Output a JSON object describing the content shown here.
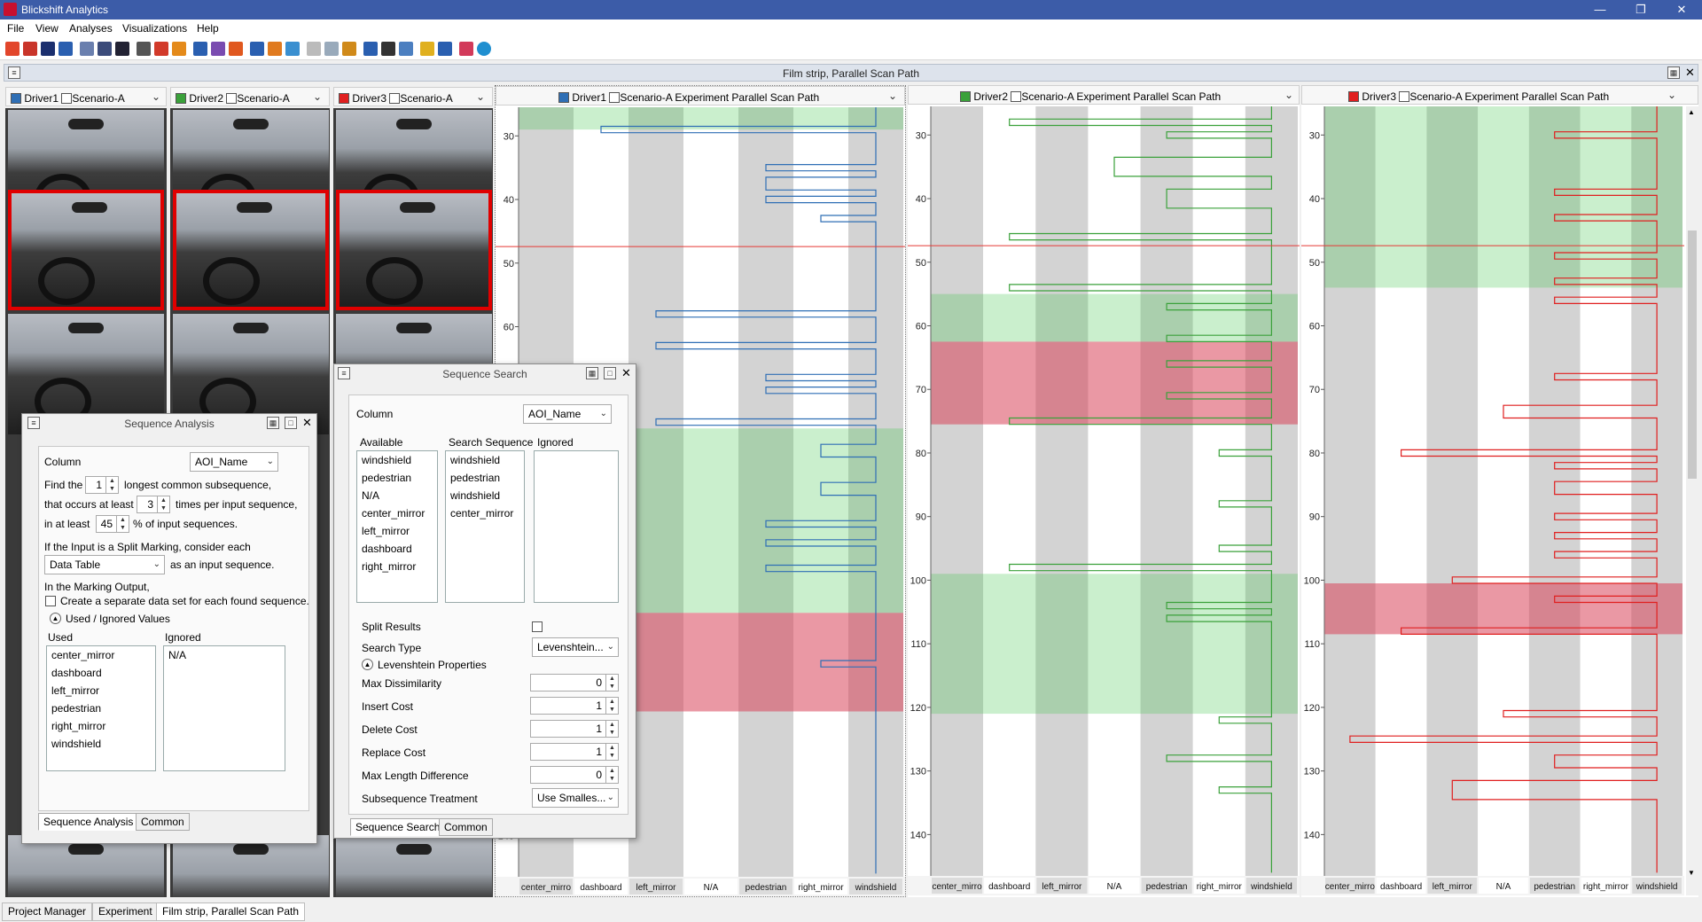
{
  "app": {
    "title": "Blickshift Analytics"
  },
  "menu": [
    "File",
    "View",
    "Analyses",
    "Visualizations",
    "Help"
  ],
  "dock_title": "Film strip, Parallel Scan Path",
  "filmstrips": [
    {
      "driver": "Driver1",
      "scenario": "Scenario-A",
      "color": "#2f6fb5"
    },
    {
      "driver": "Driver2",
      "scenario": "Scenario-A",
      "color": "#3aa13a"
    },
    {
      "driver": "Driver3",
      "scenario": "Scenario-A",
      "color": "#e01f1f"
    }
  ],
  "scanpaths": [
    {
      "driver": "Driver1",
      "scenario": "Scenario-A",
      "title_suffix": "Experiment Parallel Scan Path",
      "color": "#2f6fb5",
      "green_ranges": [
        [
          25,
          29
        ],
        [
          76,
          105
        ]
      ],
      "red_ranges": [
        [
          105,
          120.5
        ]
      ],
      "green_band_columns": "all"
    },
    {
      "driver": "Driver2",
      "scenario": "Scenario-A",
      "title_suffix": "Experiment Parallel Scan Path",
      "color": "#3aa13a",
      "green_ranges": [
        [
          55,
          62.5
        ],
        [
          99,
          121
        ]
      ],
      "red_ranges": [
        [
          62.5,
          75.5
        ]
      ],
      "green_band_columns": "all"
    },
    {
      "driver": "Driver3",
      "scenario": "Scenario-A",
      "title_suffix": "Experiment Parallel Scan Path",
      "color": "#e01f1f",
      "green_ranges": [
        [
          25,
          54
        ]
      ],
      "red_ranges": [
        [
          100.5,
          108.5
        ]
      ],
      "green_band_columns": "all"
    }
  ],
  "scanpath_axis": {
    "y_ticks": [
      30,
      40,
      50,
      60,
      70,
      80,
      90,
      100,
      110,
      120,
      130,
      140
    ],
    "ylim": [
      25.5,
      146.5
    ],
    "cursor_y": 47.4
  },
  "aoi_columns": [
    "center_mirro",
    "dashboard",
    "left_mirror",
    "N/A",
    "pedestrian",
    "right_mirror",
    "windshield"
  ],
  "chart_data": [
    {
      "type": "line",
      "title": "Driver1 Scenario-A Experiment Parallel Scan Path",
      "categories": [
        "center_mirror",
        "dashboard",
        "left_mirror",
        "N/A",
        "pedestrian",
        "right_mirror",
        "windshield"
      ],
      "points": [
        [
          6.5,
          25
        ],
        [
          6.5,
          28.5
        ],
        [
          1.5,
          28.5
        ],
        [
          1.5,
          29.5
        ],
        [
          6.5,
          29.5
        ],
        [
          6.5,
          34.5
        ],
        [
          4.5,
          34.5
        ],
        [
          4.5,
          35.5
        ],
        [
          6.5,
          35.5
        ],
        [
          6.5,
          36.5
        ],
        [
          4.5,
          36.5
        ],
        [
          4.5,
          38.5
        ],
        [
          6.5,
          38.5
        ],
        [
          6.5,
          39.5
        ],
        [
          4.5,
          39.5
        ],
        [
          4.5,
          40.5
        ],
        [
          6.5,
          40.5
        ],
        [
          6.5,
          42.5
        ],
        [
          5.5,
          42.5
        ],
        [
          5.5,
          43.5
        ],
        [
          6.5,
          43.5
        ],
        [
          6.5,
          57.5
        ],
        [
          2.5,
          57.5
        ],
        [
          2.5,
          58.5
        ],
        [
          6.5,
          58.5
        ],
        [
          6.5,
          62.5
        ],
        [
          2.5,
          62.5
        ],
        [
          2.5,
          63.5
        ],
        [
          6.5,
          63.5
        ],
        [
          6.5,
          67.5
        ],
        [
          4.5,
          67.5
        ],
        [
          4.5,
          68.5
        ],
        [
          6.5,
          68.5
        ],
        [
          6.5,
          69.5
        ],
        [
          4.5,
          69.5
        ],
        [
          4.5,
          70.5
        ],
        [
          6.5,
          70.5
        ],
        [
          6.5,
          74.5
        ],
        [
          2.5,
          74.5
        ],
        [
          2.5,
          75.5
        ],
        [
          6.5,
          75.5
        ],
        [
          6.5,
          78.5
        ],
        [
          5.5,
          78.5
        ],
        [
          5.5,
          80.5
        ],
        [
          6.5,
          80.5
        ],
        [
          6.5,
          84.5
        ],
        [
          5.5,
          84.5
        ],
        [
          5.5,
          86.5
        ],
        [
          6.5,
          86.5
        ],
        [
          6.5,
          90.5
        ],
        [
          4.5,
          90.5
        ],
        [
          4.5,
          91.5
        ],
        [
          6.5,
          91.5
        ],
        [
          6.5,
          93.5
        ],
        [
          4.5,
          93.5
        ],
        [
          4.5,
          94.5
        ],
        [
          6.5,
          94.5
        ],
        [
          6.5,
          97.5
        ],
        [
          4.5,
          97.5
        ],
        [
          4.5,
          98.5
        ],
        [
          6.5,
          98.5
        ],
        [
          6.5,
          112.5
        ],
        [
          5.5,
          112.5
        ],
        [
          5.5,
          113.5
        ],
        [
          6.5,
          113.5
        ],
        [
          6.5,
          146
        ]
      ]
    },
    {
      "type": "line",
      "title": "Driver2 Scenario-A Experiment Parallel Scan Path",
      "categories": [
        "center_mirror",
        "dashboard",
        "left_mirror",
        "N/A",
        "pedestrian",
        "right_mirror",
        "windshield"
      ],
      "points": [
        [
          6.5,
          25
        ],
        [
          6.5,
          27.5
        ],
        [
          1.5,
          27.5
        ],
        [
          1.5,
          28.5
        ],
        [
          6.5,
          28.5
        ],
        [
          6.5,
          29.5
        ],
        [
          4.5,
          29.5
        ],
        [
          4.5,
          30.5
        ],
        [
          6.5,
          30.5
        ],
        [
          6.5,
          33.5
        ],
        [
          3.5,
          33.5
        ],
        [
          3.5,
          36.5
        ],
        [
          6.5,
          36.5
        ],
        [
          6.5,
          38.5
        ],
        [
          4.5,
          38.5
        ],
        [
          4.5,
          41.5
        ],
        [
          6.5,
          41.5
        ],
        [
          6.5,
          45.5
        ],
        [
          1.5,
          45.5
        ],
        [
          1.5,
          46.5
        ],
        [
          6.5,
          46.5
        ],
        [
          6.5,
          53.5
        ],
        [
          1.5,
          53.5
        ],
        [
          1.5,
          54.5
        ],
        [
          6.5,
          54.5
        ],
        [
          6.5,
          56.5
        ],
        [
          4.5,
          56.5
        ],
        [
          4.5,
          57.5
        ],
        [
          6.5,
          57.5
        ],
        [
          6.5,
          61.5
        ],
        [
          4.5,
          61.5
        ],
        [
          4.5,
          62.5
        ],
        [
          6.5,
          62.5
        ],
        [
          6.5,
          65.5
        ],
        [
          4.5,
          65.5
        ],
        [
          4.5,
          66.5
        ],
        [
          6.5,
          66.5
        ],
        [
          6.5,
          70.5
        ],
        [
          4.5,
          70.5
        ],
        [
          4.5,
          71.5
        ],
        [
          6.5,
          71.5
        ],
        [
          6.5,
          74.5
        ],
        [
          1.5,
          74.5
        ],
        [
          1.5,
          75.5
        ],
        [
          6.5,
          75.5
        ],
        [
          6.5,
          79.5
        ],
        [
          5.5,
          79.5
        ],
        [
          5.5,
          80.5
        ],
        [
          6.5,
          80.5
        ],
        [
          6.5,
          87.5
        ],
        [
          5.5,
          87.5
        ],
        [
          5.5,
          88.5
        ],
        [
          6.5,
          88.5
        ],
        [
          6.5,
          94.5
        ],
        [
          5.5,
          94.5
        ],
        [
          5.5,
          95.5
        ],
        [
          6.5,
          95.5
        ],
        [
          6.5,
          97.5
        ],
        [
          1.5,
          97.5
        ],
        [
          1.5,
          98.5
        ],
        [
          6.5,
          98.5
        ],
        [
          6.5,
          103.5
        ],
        [
          4.5,
          103.5
        ],
        [
          4.5,
          104.5
        ],
        [
          6.5,
          104.5
        ],
        [
          6.5,
          105.5
        ],
        [
          4.5,
          105.5
        ],
        [
          4.5,
          106.5
        ],
        [
          6.5,
          106.5
        ],
        [
          6.5,
          121.5
        ],
        [
          5.5,
          121.5
        ],
        [
          5.5,
          122.5
        ],
        [
          6.5,
          122.5
        ],
        [
          6.5,
          127.5
        ],
        [
          4.5,
          127.5
        ],
        [
          4.5,
          128.5
        ],
        [
          6.5,
          128.5
        ],
        [
          6.5,
          132.5
        ],
        [
          5.5,
          132.5
        ],
        [
          5.5,
          133.5
        ],
        [
          6.5,
          133.5
        ],
        [
          6.5,
          146
        ]
      ]
    },
    {
      "type": "line",
      "title": "Driver3 Scenario-A Experiment Parallel Scan Path",
      "categories": [
        "center_mirror",
        "dashboard",
        "left_mirror",
        "N/A",
        "pedestrian",
        "right_mirror",
        "windshield"
      ],
      "points": [
        [
          6.5,
          25
        ],
        [
          6.5,
          29.5
        ],
        [
          4.5,
          29.5
        ],
        [
          4.5,
          30.5
        ],
        [
          6.5,
          30.5
        ],
        [
          6.5,
          38.5
        ],
        [
          4.5,
          38.5
        ],
        [
          4.5,
          39.5
        ],
        [
          6.5,
          39.5
        ],
        [
          6.5,
          42.5
        ],
        [
          4.5,
          42.5
        ],
        [
          4.5,
          43.5
        ],
        [
          6.5,
          43.5
        ],
        [
          6.5,
          48.5
        ],
        [
          4.5,
          48.5
        ],
        [
          4.5,
          49.5
        ],
        [
          6.5,
          49.5
        ],
        [
          6.5,
          52.5
        ],
        [
          4.5,
          52.5
        ],
        [
          4.5,
          53.5
        ],
        [
          6.5,
          53.5
        ],
        [
          6.5,
          55.5
        ],
        [
          4.5,
          55.5
        ],
        [
          4.5,
          56.5
        ],
        [
          6.5,
          56.5
        ],
        [
          6.5,
          67.5
        ],
        [
          4.5,
          67.5
        ],
        [
          4.5,
          68.5
        ],
        [
          6.5,
          68.5
        ],
        [
          6.5,
          72.5
        ],
        [
          3.5,
          72.5
        ],
        [
          3.5,
          74.5
        ],
        [
          6.5,
          74.5
        ],
        [
          6.5,
          79.5
        ],
        [
          1.5,
          79.5
        ],
        [
          1.5,
          80.5
        ],
        [
          6.5,
          80.5
        ],
        [
          6.5,
          81.5
        ],
        [
          4.5,
          81.5
        ],
        [
          4.5,
          82.5
        ],
        [
          6.5,
          82.5
        ],
        [
          6.5,
          84.5
        ],
        [
          4.5,
          84.5
        ],
        [
          4.5,
          86.5
        ],
        [
          6.5,
          86.5
        ],
        [
          6.5,
          89.5
        ],
        [
          4.5,
          89.5
        ],
        [
          4.5,
          90.5
        ],
        [
          6.5,
          90.5
        ],
        [
          6.5,
          92.5
        ],
        [
          4.5,
          92.5
        ],
        [
          4.5,
          93.5
        ],
        [
          6.5,
          93.5
        ],
        [
          6.5,
          95.5
        ],
        [
          4.5,
          95.5
        ],
        [
          4.5,
          96.5
        ],
        [
          6.5,
          96.5
        ],
        [
          6.5,
          99.5
        ],
        [
          2.5,
          99.5
        ],
        [
          2.5,
          100.5
        ],
        [
          6.5,
          100.5
        ],
        [
          6.5,
          102.5
        ],
        [
          4.5,
          102.5
        ],
        [
          4.5,
          103.5
        ],
        [
          6.5,
          103.5
        ],
        [
          6.5,
          107.5
        ],
        [
          1.5,
          107.5
        ],
        [
          1.5,
          108.5
        ],
        [
          6.5,
          108.5
        ],
        [
          6.5,
          120.5
        ],
        [
          3.5,
          120.5
        ],
        [
          3.5,
          121.5
        ],
        [
          6.5,
          121.5
        ],
        [
          6.5,
          124.5
        ],
        [
          0.5,
          124.5
        ],
        [
          0.5,
          125.5
        ],
        [
          6.5,
          125.5
        ],
        [
          6.5,
          127.5
        ],
        [
          4.5,
          127.5
        ],
        [
          4.5,
          129.5
        ],
        [
          6.5,
          129.5
        ],
        [
          6.5,
          131.5
        ],
        [
          2.5,
          131.5
        ],
        [
          2.5,
          134.5
        ],
        [
          6.5,
          134.5
        ],
        [
          6.5,
          146
        ]
      ]
    }
  ],
  "seq_analysis": {
    "title": "Sequence Analysis",
    "column_label": "Column",
    "column_value": "AOI_Name",
    "find_the": "Find the",
    "find_value": "1",
    "longest": "longest common subsequence,",
    "occurs": "that occurs at least",
    "occurs_value": "3",
    "times": "times per input sequence,",
    "atleast": "in at least",
    "atleast_value": "45",
    "percent": "% of input sequences.",
    "split_text": "If the Input is a Split Marking, consider each",
    "split_value": "Data Table",
    "as_input": "as an input sequence.",
    "marking_output": "In the Marking Output,",
    "create_separate": "Create a separate data set for each found sequence.",
    "used_ignored": "Used / Ignored Values",
    "used_label": "Used",
    "ignored_label": "Ignored",
    "used": [
      "center_mirror",
      "dashboard",
      "left_mirror",
      "pedestrian",
      "right_mirror",
      "windshield"
    ],
    "ignored": [
      "N/A"
    ],
    "tabs": [
      "Sequence Analysis",
      "Common"
    ]
  },
  "seq_search": {
    "title": "Sequence Search",
    "column_label": "Column",
    "column_value": "AOI_Name",
    "available_label": "Available",
    "search_label": "Search Sequence",
    "ignored_label": "Ignored",
    "available": [
      "windshield",
      "pedestrian",
      "N/A",
      "center_mirror",
      "left_mirror",
      "dashboard",
      "right_mirror"
    ],
    "search": [
      "windshield",
      "pedestrian",
      "windshield",
      "center_mirror"
    ],
    "ignored": [],
    "split_results": "Split Results",
    "search_type_label": "Search Type",
    "search_type_value": "Levenshtein...",
    "lev_props": "Levenshtein Properties",
    "props": [
      {
        "label": "Max Dissimilarity",
        "value": "0"
      },
      {
        "label": "Insert Cost",
        "value": "1"
      },
      {
        "label": "Delete Cost",
        "value": "1"
      },
      {
        "label": "Replace Cost",
        "value": "1"
      },
      {
        "label": "Max Length Difference",
        "value": "0"
      }
    ],
    "subseq_label": "Subsequence Treatment",
    "subseq_value": "Use Smalles...",
    "tabs": [
      "Sequence Search",
      "Common"
    ]
  },
  "status_tabs": [
    "Project Manager",
    "Experiment",
    "Film strip, Parallel Scan Path"
  ]
}
